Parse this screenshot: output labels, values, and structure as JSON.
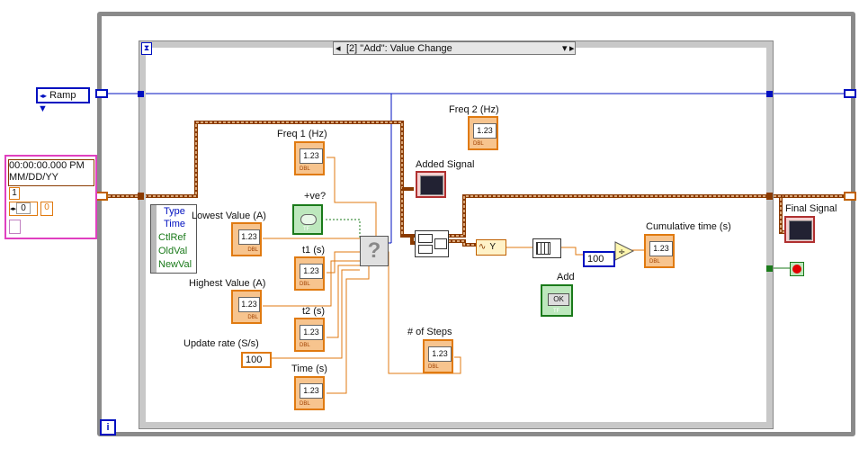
{
  "enum_ramp": "Ramp",
  "enum_ramp_arrow": "▼",
  "case_selector": "[2] \"Add\": Value Change",
  "case_left_arrow": "◂",
  "case_right_arrow": "▸",
  "case_dropdown": "▾",
  "timestamp": {
    "line1": "00:00:00.000 PM",
    "line2": "MM/DD/YY",
    "c1": "1",
    "c2": "0",
    "c3": "0"
  },
  "event_data": [
    "Type",
    "Time",
    "CtlRef",
    "OldVal",
    "NewVal"
  ],
  "labels": {
    "freq1": "Freq 1 (Hz)",
    "freq2": "Freq 2 (Hz)",
    "positive": "+ve?",
    "lowest": "Lowest Value (A)",
    "t1": "t1 (s)",
    "highest": "Highest Value (A)",
    "t2": "t2 (s)",
    "update": "Update rate (S/s)",
    "time": "Time (s)",
    "added_signal": "Added Signal",
    "cumulative": "Cumulative time (s)",
    "add": "Add",
    "steps": "# of Steps",
    "final_signal": "Final Signal"
  },
  "num_face": "1.23",
  "num_tag": "DBL",
  "bool_tag": "TF",
  "ok_label": "OK",
  "const_update": "100",
  "const_100": "100",
  "express_y": "Y",
  "question_mark": "?",
  "iteration": "i",
  "colors": {
    "dbl_orange": "#e07a10",
    "ref_blue": "#0010c0",
    "waveform_brown": "#8a3a00",
    "bool_green": "#1a7a1a"
  }
}
